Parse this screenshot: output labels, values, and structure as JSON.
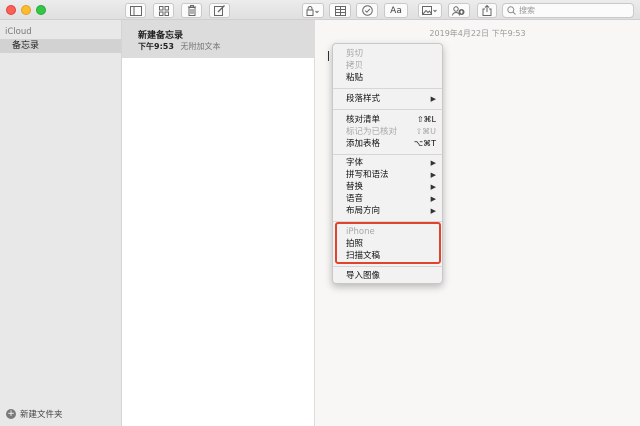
{
  "toolbar": {
    "search_placeholder": "搜索",
    "format_label": "Aa"
  },
  "sidebar": {
    "account": "iCloud",
    "folder": "备忘录",
    "new_folder_label": "新建文件夹"
  },
  "notes": {
    "title": "新建备忘录",
    "time": "下午9:53",
    "preview": "无附加文本"
  },
  "editor": {
    "date": "2019年4月22日 下午9:53"
  },
  "context_menu": {
    "items": [
      {
        "label": "剪切",
        "enabled": false
      },
      {
        "label": "拷贝",
        "enabled": false
      },
      {
        "label": "粘贴",
        "enabled": true
      },
      {
        "label": "段落样式",
        "enabled": true,
        "submenu": true
      },
      {
        "label": "核对清单",
        "enabled": true,
        "shortcut": "⇧⌘L"
      },
      {
        "label": "标记为已核对",
        "enabled": false,
        "shortcut": "⇧⌘U"
      },
      {
        "label": "添加表格",
        "enabled": true,
        "shortcut": "⌥⌘T"
      },
      {
        "label": "字体",
        "enabled": true,
        "submenu": true
      },
      {
        "label": "拼写和语法",
        "enabled": true,
        "submenu": true
      },
      {
        "label": "替换",
        "enabled": true,
        "submenu": true
      },
      {
        "label": "语音",
        "enabled": true,
        "submenu": true
      },
      {
        "label": "布局方向",
        "enabled": true,
        "submenu": true
      },
      {
        "label": "iPhone",
        "enabled": false
      },
      {
        "label": "拍照",
        "enabled": true
      },
      {
        "label": "扫描文稿",
        "enabled": true
      },
      {
        "label": "导入图像",
        "enabled": true
      }
    ],
    "submenu_arrow": "▶"
  },
  "colors": {
    "highlight": "#e0442d",
    "close": "#fc5f57",
    "minimize": "#fdbc2e",
    "zoom": "#33c748"
  }
}
